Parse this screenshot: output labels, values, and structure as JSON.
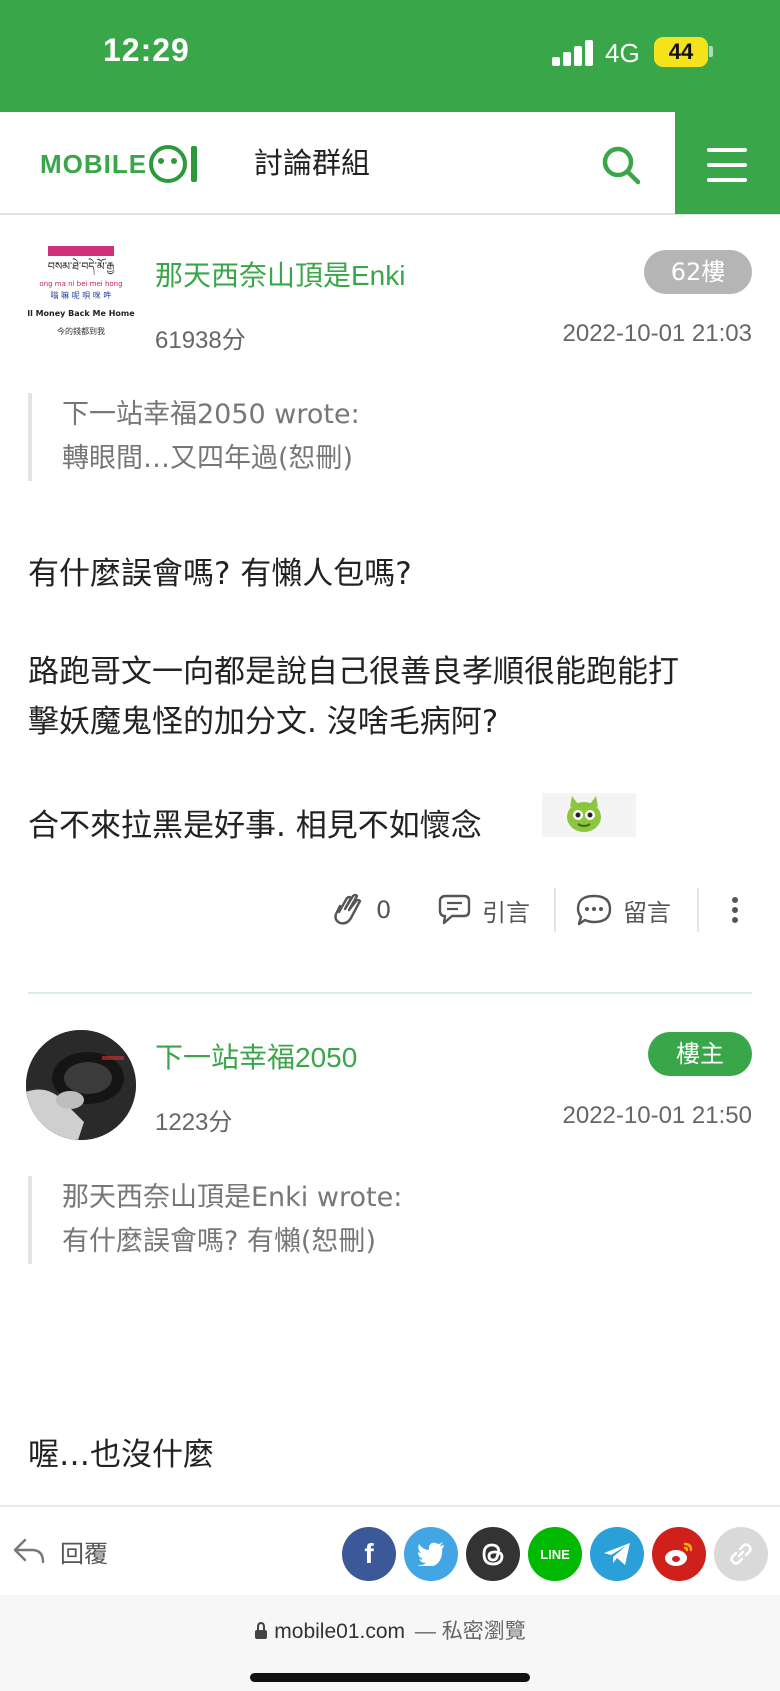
{
  "status_bar": {
    "time": "12:29",
    "network": "4G",
    "battery": "44"
  },
  "header": {
    "title": "討論群組",
    "logo_text": "MOBILE"
  },
  "posts": [
    {
      "username": "那天西奈山頂是Enki",
      "floor": "62樓",
      "score": "61938分",
      "date": "2022-10-01 21:03",
      "avatar_lines": [
        "བསམ་ཐེ་བདེ་མོ་རྒྱ",
        "ong ma ni bei mei hong",
        "嗡 嘛 呢 唄 咪 吽",
        "ll Money Back Me Home",
        "今的錢都到我"
      ],
      "quote": [
        "下一站幸福2050 wrote:",
        "轉眼間…又四年過(恕刪)"
      ],
      "body": [
        "有什麼誤會嗎? 有懶人包嗎?",
        "路跑哥文一向都是說自己很善良孝順很能跑能打",
        "擊妖魔鬼怪的加分文. 沒啥毛病阿?",
        "合不來拉黑是好事. 相見不如懷念"
      ],
      "actions": {
        "likes": "0",
        "quote_label": "引言",
        "comment_label": "留言"
      }
    },
    {
      "username": "下一站幸福2050",
      "floor": "樓主",
      "score": "1223分",
      "date": "2022-10-01 21:50",
      "quote": [
        "那天西奈山頂是Enki wrote:",
        "有什麼誤會嗎? 有懶(恕刪)"
      ],
      "body": [
        "喔…也沒什麼"
      ]
    }
  ],
  "bottom_bar": {
    "reply_label": "回覆",
    "share_icons": [
      "facebook-icon",
      "twitter-icon",
      "threads-icon",
      "line-icon",
      "telegram-icon",
      "weibo-icon",
      "link-icon"
    ],
    "share_text": {
      "facebook": "f",
      "line": "LINE"
    },
    "colors": {
      "facebook": "#3b5998",
      "twitter": "#41a6e3",
      "threads": "#333333",
      "line": "#00b900",
      "telegram": "#2a9fd8",
      "weibo": "#d0201c",
      "link": "#d9d9d9"
    }
  },
  "browser": {
    "url": "mobile01.com",
    "mode": "— 私密瀏覽"
  },
  "colors": {
    "brand": "#3aa64a",
    "floor_badge_gray": "#b5b5b5"
  }
}
